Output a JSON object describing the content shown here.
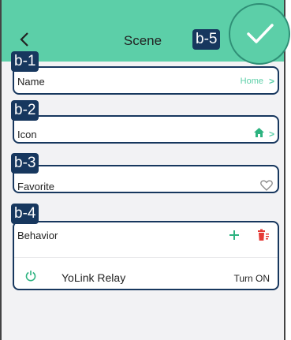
{
  "header": {
    "title": "Scene",
    "accent": "#5ccfa8"
  },
  "badges": {
    "b1": "b-1",
    "b2": "b-2",
    "b3": "b-3",
    "b4": "b-4",
    "b5": "b-5"
  },
  "rows": {
    "name": {
      "label": "Name",
      "value": "Home"
    },
    "icon": {
      "label": "Icon",
      "icon": "home-icon"
    },
    "favorite": {
      "label": "Favorite",
      "icon": "heart-outline-icon"
    },
    "behavior": {
      "label": "Behavior",
      "add_icon": "plus-icon",
      "delete_icon": "trash-icon",
      "device": {
        "icon": "power-icon",
        "name": "YoLink Relay",
        "action": "Turn ON"
      }
    }
  },
  "colors": {
    "badge": "#17375e",
    "delete": "#e53935"
  }
}
